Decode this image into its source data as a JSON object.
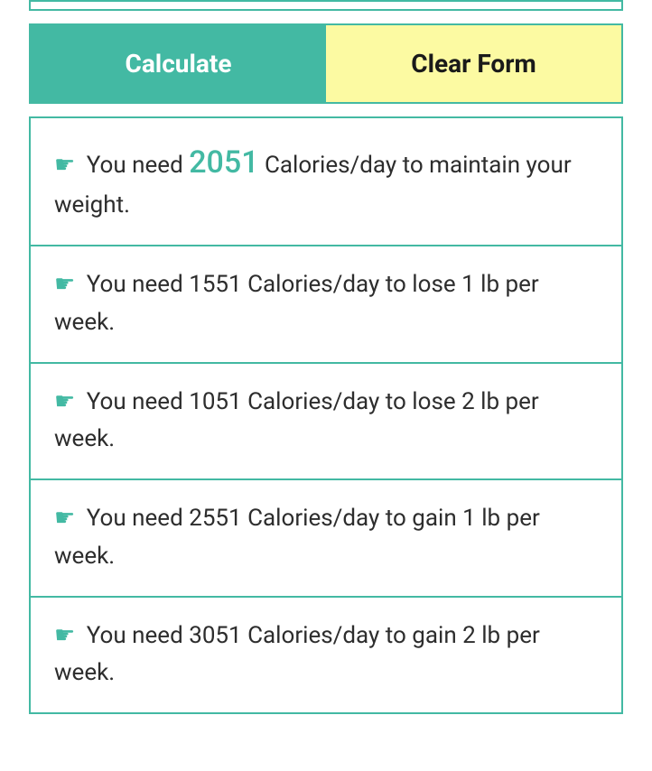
{
  "buttons": {
    "calculate": "Calculate",
    "clear": "Clear Form"
  },
  "results": {
    "maintain": {
      "prefix": "You need ",
      "value": "2051",
      "suffix": " Calories/day to maintain your weight."
    },
    "lose1": "You need 1551 Calories/day to lose 1 lb per week.",
    "lose2": "You need 1051 Calories/day to lose 2 lb per week.",
    "gain1": "You need 2551 Calories/day to gain 1 lb per week.",
    "gain2": "You need 3051 Calories/day to gain 2 lb per week."
  }
}
